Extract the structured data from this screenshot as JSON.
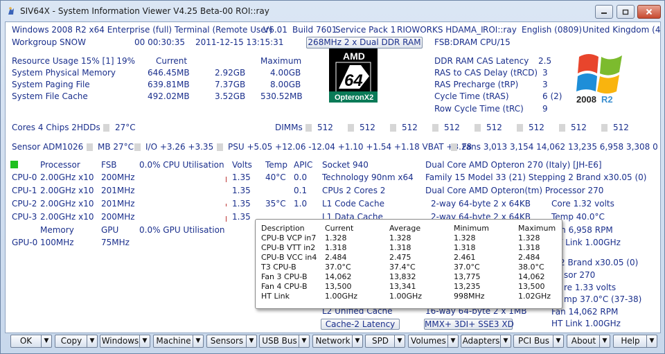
{
  "window": {
    "title": "SIV64X - System Information Viewer V4.25 Beta-00 ROI::ray"
  },
  "info": {
    "line1": [
      "Windows 2008 R2 x64 Enterprise (full) Terminal (Remote User)",
      "V6.01",
      "Build 7601",
      "Service Pack 1",
      "RIOWORKS HDAMA_I",
      "ROI::ray",
      "English (0809)",
      "United Kingdom (44"
    ],
    "workgroup": "Workgroup SNOW",
    "uptime": "00 00:30:35",
    "datetime": "2011-12-15 13:15:31",
    "ram_button": "268MHz 2 x Dual DDR RAM",
    "fsb": "FSB:DRAM CPU/15"
  },
  "resources": {
    "header": {
      "label": "Resource Usage 15% [1] 19%",
      "current": "Current",
      "maximum": "Maximum"
    },
    "rows": [
      {
        "label": "System Physical Memory",
        "current": "646.45MB",
        "mid": "2.92GB",
        "max": "4.00GB"
      },
      {
        "label": "System Paging File",
        "current": "639.81MB",
        "mid": "7.37GB",
        "max": "8.00GB"
      },
      {
        "label": "System File Cache",
        "current": "492.02MB",
        "mid": "3.52GB",
        "max": "530.52MB"
      }
    ]
  },
  "chip_logo": {
    "brand": "AMD",
    "number": "64",
    "model": "OpteronX2"
  },
  "os_logo": {
    "text": "2008",
    "suffix": "R2"
  },
  "timings": [
    {
      "label": "DDR RAM CAS Latency",
      "value": "2.5"
    },
    {
      "label": "RAS to CAS Delay (tRCD)",
      "value": "3"
    },
    {
      "label": "RAS Precharge (tRP)",
      "value": "3"
    },
    {
      "label": "Cycle Time (tRAS)",
      "value": "6 (2)"
    },
    {
      "label": "Row Cycle Time (tRC)",
      "value": "9"
    }
  ],
  "cores": {
    "label": "Cores 4 Chips 2",
    "hdds": "HDDs",
    "hdd_temp": "27°C",
    "dimms": "DIMMs",
    "dimm_sizes": [
      "512",
      "512",
      "512",
      "512",
      "512",
      "512",
      "512",
      "512"
    ]
  },
  "sensor": {
    "label": "Sensor ADM1026",
    "mb": "MB 27°C",
    "io": "I/O +3.26 +3.35",
    "psu": "PSU +5.05 +12.06 -12.04 +1.10 +1.54 +1.18 VBAT +3.28",
    "fans": "Fans 3,013 3,154 14,062 13,235 6,958 3,308 0 0"
  },
  "cpu_table": {
    "headers": {
      "processor": "Processor",
      "fsb": "FSB",
      "util": "0.0% CPU Utilisation",
      "volts": "Volts",
      "temp": "Temp",
      "apic": "APIC"
    },
    "rows": [
      {
        "name": "CPU-0",
        "clock": "2.00GHz x10",
        "fsb": "200MHz",
        "volts": "1.35",
        "temp": "40°C",
        "apic": "0.0"
      },
      {
        "name": "CPU-1",
        "clock": "2.00GHz x10",
        "fsb": "201MHz",
        "volts": "1.35",
        "temp": "",
        "apic": "0.1"
      },
      {
        "name": "CPU-2",
        "clock": "2.00GHz x10",
        "fsb": "201MHz",
        "volts": "1.35",
        "temp": "35°C",
        "apic": "1.0"
      },
      {
        "name": "CPU-3",
        "clock": "2.00GHz x10",
        "fsb": "200MHz",
        "volts": "1.35",
        "temp": "",
        "apic": "1.1"
      }
    ],
    "gpu_headers": {
      "memory": "Memory",
      "gpu": "GPU",
      "util": "0.0% GPU Utilisation"
    },
    "gpu_row": {
      "name": "GPU-0",
      "memory": "100MHz",
      "gpu": "75MHz"
    }
  },
  "cpu_details": {
    "socket": "Socket 940",
    "tech": "Technology 90nm  x64",
    "cpus": "CPUs 2 Cores 2",
    "l1code": "L1 Code Cache",
    "l1data": "L1 Data Cache",
    "l2": "L2 Unified Cache",
    "name": "Dual Core AMD Opteron 270 (Italy) [JH-E6]",
    "family": "Family 15  Model 33 (21)  Stepping 2  Brand x30.05 (0)",
    "proc_name": "Dual Core AMD Opteron(tm) Processor 270",
    "l1code_val": "2-way 64-byte  2 x 64KB",
    "l1data_val": "2-way 64-byte  2 x 64KB",
    "l2_val": "16-way 64-byte  2 x 1MB",
    "core_volts": "Core 1.32 volts",
    "temp": "Temp 40.0°C",
    "fan": "Fan  6,958 RPM",
    "ht": "HT Link 1.00GHz",
    "brand2": "2  Brand x30.05 (0)",
    "sor": "sor 270",
    "core2": "re 1.33 volts",
    "temp2": "mp 37.0°C (37-38)",
    "fan2": "Fan  14,062 RPM",
    "ht2": "HT Link 1.00GHz"
  },
  "mid_buttons": {
    "cache2": "Cache-2 Latency",
    "mmx": "MMX+ 3DI+ SSE3 XD"
  },
  "tooltip": {
    "headers": [
      "Description",
      "Current",
      "Average",
      "Minimum",
      "Maximum"
    ],
    "rows": [
      [
        "CPU-B VCP in7",
        "1.328",
        "1.328",
        "1.328",
        "1.328"
      ],
      [
        "CPU-B VTT in2",
        "1.318",
        "1.318",
        "1.318",
        "1.318"
      ],
      [
        "CPU-B VCC in4",
        "2.484",
        "2.475",
        "2.461",
        "2.484"
      ],
      [
        "T3 CPU-B",
        "37.0°C",
        "37.4°C",
        "37.0°C",
        "38.0°C"
      ],
      [
        "Fan 3 CPU-B",
        "14,062",
        "13,832",
        "13,775",
        "14,062"
      ],
      [
        "Fan 4 CPU-B",
        "13,500",
        "13,341",
        "13,235",
        "13,500"
      ],
      [
        "HT Link",
        "1.00GHz",
        "1.00GHz",
        "998MHz",
        "1.02GHz"
      ]
    ]
  },
  "buttons": [
    "OK",
    "Copy",
    "Windows",
    "Machine",
    "Sensors",
    "USB Bus",
    "Network",
    "SPD",
    "Volumes",
    "Adapters",
    "PCI Bus",
    "About",
    "Help"
  ]
}
